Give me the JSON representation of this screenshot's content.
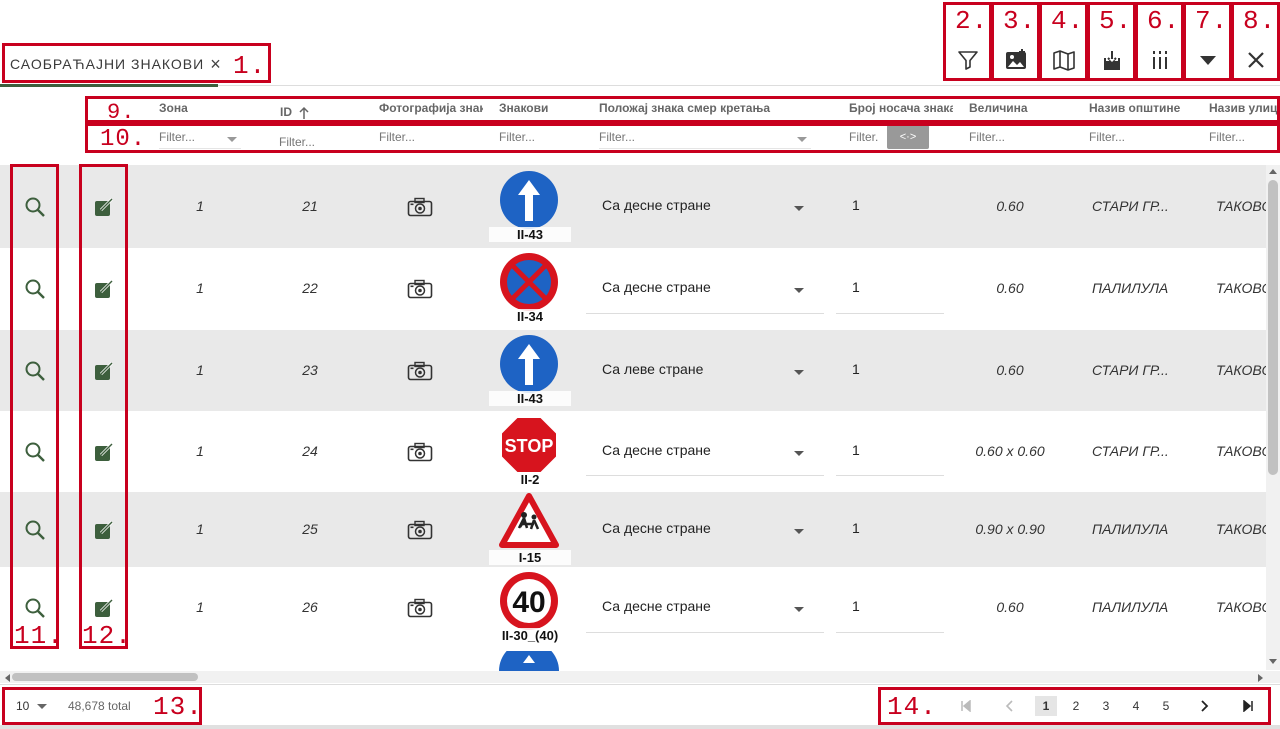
{
  "tab": {
    "label": "САОБРАЋАЈНИ ЗНАКОВИ",
    "close": "×"
  },
  "annotations": [
    "1.",
    "2.",
    "3.",
    "4.",
    "5.",
    "6.",
    "7.",
    "8.",
    "9.",
    "10.",
    "11.",
    "12.",
    "13.",
    "14."
  ],
  "toolbar": [
    "filter-icon",
    "image-icon",
    "map-icon",
    "download-icon",
    "columns-icon",
    "caret-down-icon",
    "close-icon"
  ],
  "columns": {
    "zona": "Зона",
    "id": "ID",
    "foto": "Фотографија знак",
    "znakovi": "Знакови",
    "polozaj": "Положај знака смер кретања",
    "broj": "Број носача знака",
    "velicina": "Величина",
    "opstina": "Назив општине",
    "ulica": "Назив улице"
  },
  "filter_placeholder": "Filter...",
  "filter_short": "Filter.",
  "toggle_label": "<·>",
  "rows": [
    {
      "zona": "1",
      "id": "21",
      "code": "II-43",
      "polozaj": "Са десне стране",
      "broj": "1",
      "velicina": "0.60",
      "opstina": "СТАРИ ГР...",
      "ulica": "ТАКОВС"
    },
    {
      "zona": "1",
      "id": "22",
      "code": "II-34",
      "polozaj": "Са десне стране",
      "broj": "1",
      "velicina": "0.60",
      "opstina": "ПАЛИЛУЛА",
      "ulica": "ТАКОВС"
    },
    {
      "zona": "1",
      "id": "23",
      "code": "II-43",
      "polozaj": "Са леве стране",
      "broj": "1",
      "velicina": "0.60",
      "opstina": "СТАРИ ГР...",
      "ulica": "ТАКОВС"
    },
    {
      "zona": "1",
      "id": "24",
      "code": "II-2",
      "polozaj": "Са десне стране",
      "broj": "1",
      "velicina": "0.60 x 0.60",
      "opstina": "СТАРИ ГР...",
      "ulica": "ТАКОВС"
    },
    {
      "zona": "1",
      "id": "25",
      "code": "I-15",
      "polozaj": "Са десне стране",
      "broj": "1",
      "velicina": "0.90 x 0.90",
      "opstina": "ПАЛИЛУЛА",
      "ulica": "ТАКОВС"
    },
    {
      "zona": "1",
      "id": "26",
      "code": "II-30_(40)",
      "polozaj": "Са десне стране",
      "broj": "1",
      "velicina": "0.60",
      "opstina": "ПАЛИЛУЛА",
      "ulica": "ТАКОВС"
    }
  ],
  "sign_texts": {
    "stop": "STOP",
    "speed": "40"
  },
  "footer": {
    "page_size": "10",
    "total": "48,678 total",
    "pages": [
      "1",
      "2",
      "3",
      "4",
      "5"
    ],
    "active_page": "1"
  },
  "colors": {
    "accent": "#3d5f3d",
    "annotation": "#c8001e",
    "sign_blue": "#1e63c4",
    "sign_red": "#d7141e"
  }
}
